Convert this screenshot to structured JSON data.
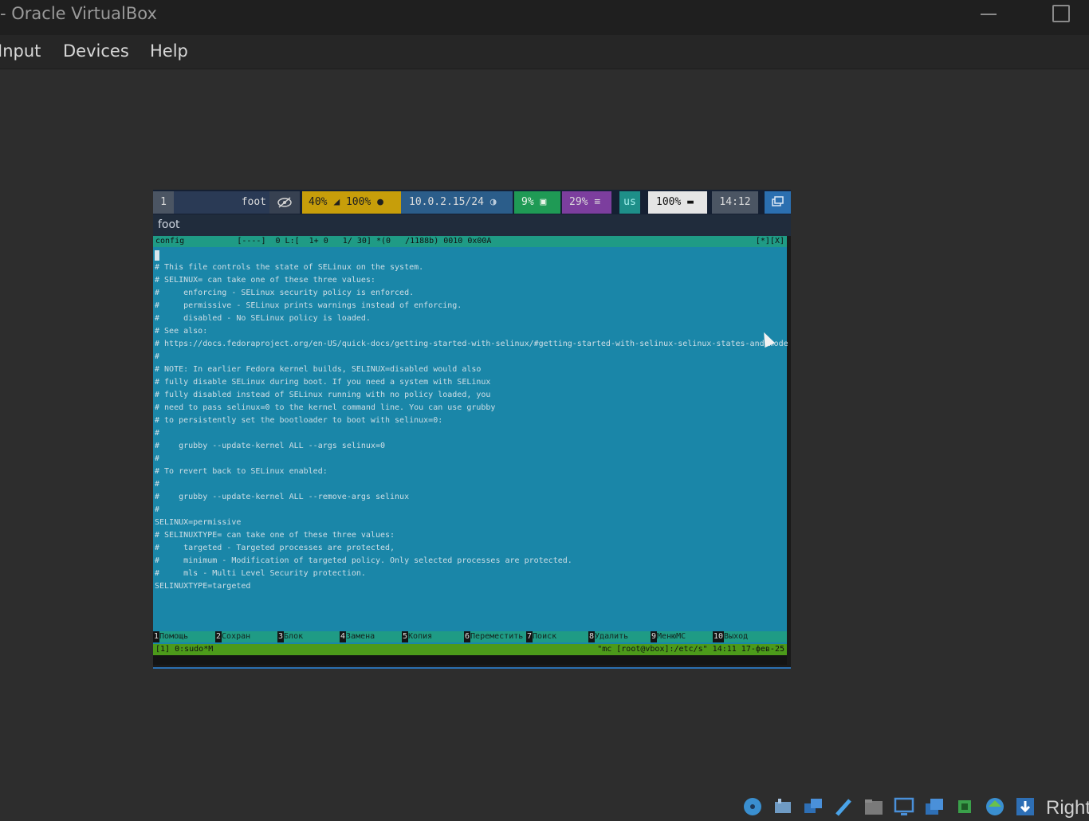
{
  "window": {
    "title": "- Oracle VirtualBox"
  },
  "menubar": {
    "items": [
      "Input",
      "Devices",
      "Help"
    ]
  },
  "waybar": {
    "workspace": "1",
    "app": "foot",
    "volume": "40%",
    "mic": "100%",
    "network": "10.0.2.15/24",
    "cpu": "9%",
    "memory": "29%",
    "keyboard": "us",
    "battery": "100%",
    "clock": "14:12"
  },
  "terminal": {
    "title": "foot",
    "editor_header": "config           [----]  0 L:[  1+ 0   1/ 30] *(0   /1188b) 0010 0x00A",
    "editor_header_right": "[*][X]",
    "lines": [
      "# This file controls the state of SELinux on the system.",
      "# SELINUX= can take one of these three values:",
      "#     enforcing - SELinux security policy is enforced.",
      "#     permissive - SELinux prints warnings instead of enforcing.",
      "#     disabled - No SELinux policy is loaded.",
      "# See also:",
      "# https://docs.fedoraproject.org/en-US/quick-docs/getting-started-with-selinux/#getting-started-with-selinux-selinux-states-and-mode",
      "#",
      "# NOTE: In earlier Fedora kernel builds, SELINUX=disabled would also",
      "# fully disable SELinux during boot. If you need a system with SELinux",
      "# fully disabled instead of SELinux running with no policy loaded, you",
      "# need to pass selinux=0 to the kernel command line. You can use grubby",
      "# to persistently set the bootloader to boot with selinux=0:",
      "#",
      "#    grubby --update-kernel ALL --args selinux=0",
      "#",
      "# To revert back to SELinux enabled:",
      "#",
      "#    grubby --update-kernel ALL --remove-args selinux",
      "#",
      "SELINUX=permissive",
      "# SELINUXTYPE= can take one of these three values:",
      "#     targeted - Targeted processes are protected,",
      "#     minimum - Modification of targeted policy. Only selected processes are protected.",
      "#     mls - Multi Level Security protection.",
      "SELINUXTYPE=targeted"
    ],
    "fkeys": [
      {
        "n": "1",
        "label": "Помощь"
      },
      {
        "n": "2",
        "label": "Сохран"
      },
      {
        "n": "3",
        "label": "Блок"
      },
      {
        "n": "4",
        "label": "Замена"
      },
      {
        "n": "5",
        "label": "Копия"
      },
      {
        "n": "6",
        "label": "Переместить"
      },
      {
        "n": "7",
        "label": "Поиск"
      },
      {
        "n": "8",
        "label": "Удалить"
      },
      {
        "n": "9",
        "label": "МенюMC"
      },
      {
        "n": "10",
        "label": "Выход"
      }
    ],
    "status_left": "[1] 0:sudo*M",
    "status_right": "\"mc [root@vbox]:/etc/s\" 14:11 17-фев-25"
  },
  "statusbar": {
    "host_key": "Right"
  }
}
